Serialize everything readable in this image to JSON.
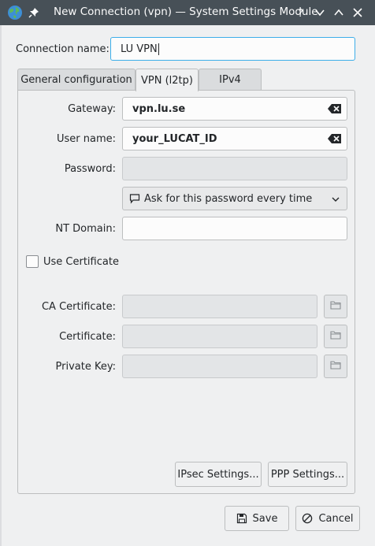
{
  "titlebar": {
    "title": "New Connection (vpn) — System Settings Module",
    "icons": [
      "globe-icon",
      "pin-icon",
      "help-icon",
      "minimize-icon",
      "maximize-icon",
      "close-icon"
    ]
  },
  "connection_name": {
    "label": "Connection name:",
    "value": "LU VPN"
  },
  "tabs": [
    {
      "label": "General configuration",
      "active": false
    },
    {
      "label": "VPN (l2tp)",
      "active": true
    },
    {
      "label": "IPv4",
      "active": false
    }
  ],
  "form": {
    "gateway": {
      "label": "Gateway:",
      "value": "vpn.lu.se"
    },
    "username": {
      "label": "User name:",
      "value": "your_LUCAT_ID"
    },
    "password": {
      "label": "Password:",
      "value": ""
    },
    "password_mode": {
      "value": "Ask for this password every time",
      "icon": "password-prompt-icon"
    },
    "nt_domain": {
      "label": "NT Domain:",
      "value": ""
    },
    "use_certificate": {
      "label": "Use Certificate",
      "checked": false
    },
    "ca_certificate": {
      "label": "CA Certificate:",
      "value": ""
    },
    "certificate": {
      "label": "Certificate:",
      "value": ""
    },
    "private_key": {
      "label": "Private Key:",
      "value": ""
    }
  },
  "panel_buttons": {
    "ipsec": "IPsec Settings...",
    "ppp": "PPP Settings..."
  },
  "dialog_buttons": {
    "save": "Save",
    "cancel": "Cancel"
  },
  "colors": {
    "titlebar_bg": "#475057",
    "focus_border": "#3daee9",
    "window_bg": "#eff0f1"
  }
}
